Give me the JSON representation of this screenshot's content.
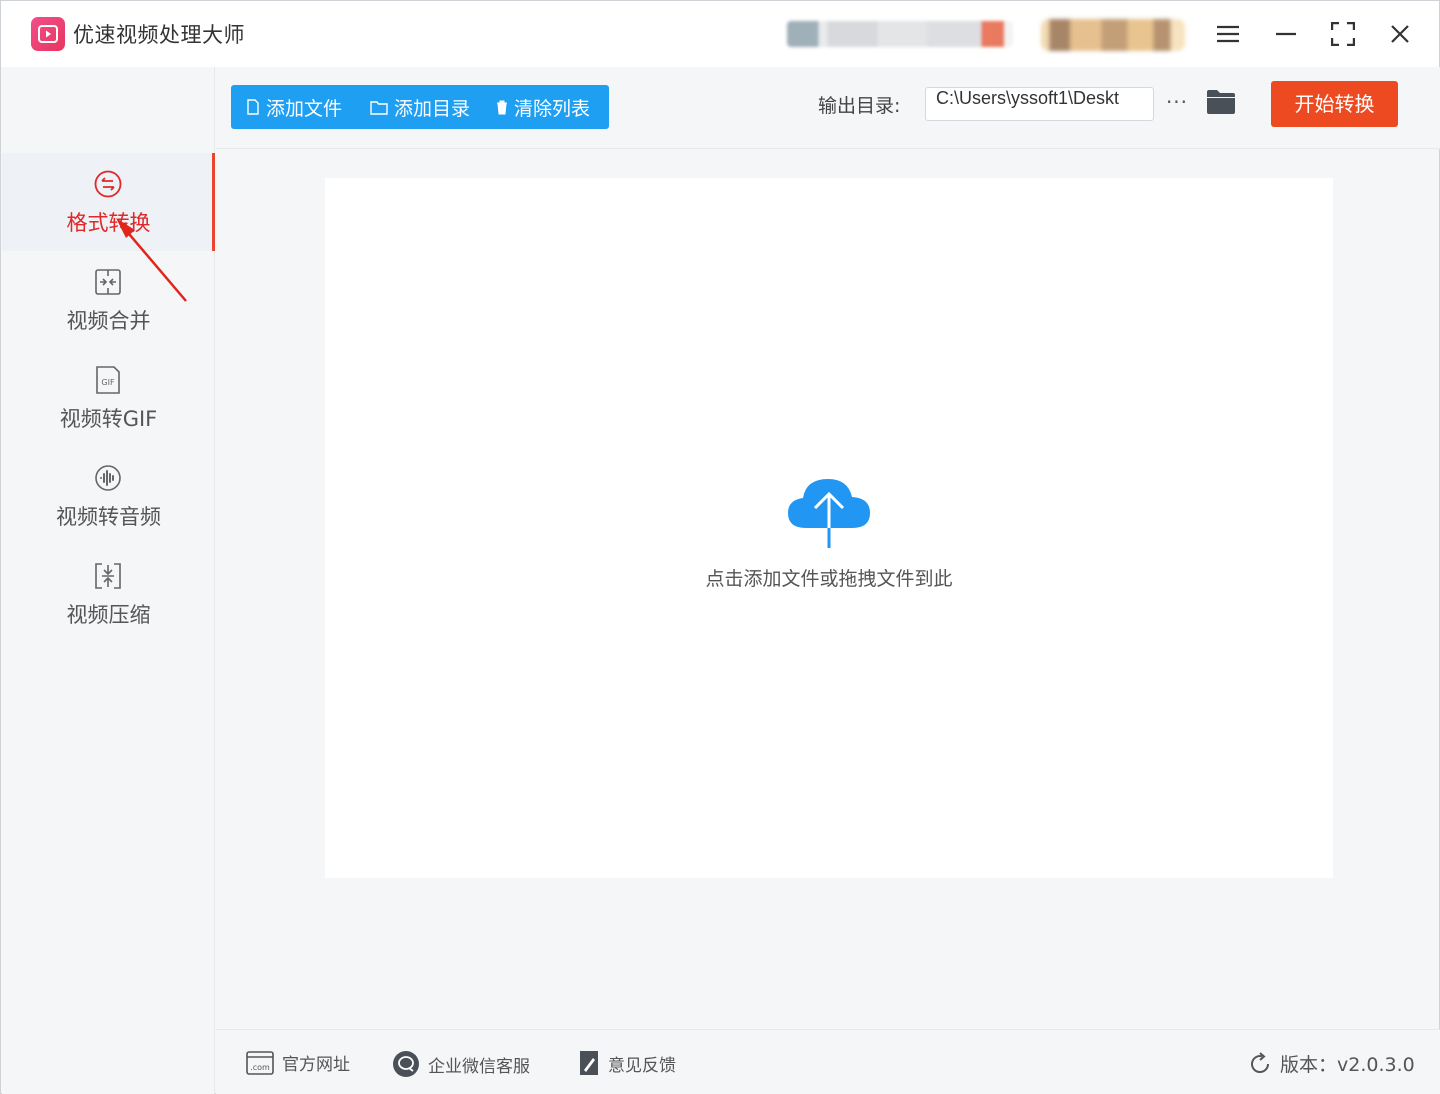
{
  "app": {
    "title": "优速视频处理大师",
    "logo_icon": "video-play-icon",
    "brand_color": "#e8355d"
  },
  "window_controls": [
    "menu-icon",
    "minimize-icon",
    "maximize-icon",
    "close-icon"
  ],
  "sidebar": {
    "items": [
      {
        "label": "格式转换",
        "icon": "convert-icon",
        "active": true
      },
      {
        "label": "视频合并",
        "icon": "merge-icon",
        "active": false
      },
      {
        "label": "视频转GIF",
        "icon": "gif-file-icon",
        "active": false
      },
      {
        "label": "视频转音频",
        "icon": "audio-icon",
        "active": false
      },
      {
        "label": "视频压缩",
        "icon": "compress-icon",
        "active": false
      }
    ],
    "active_color": "#e02828"
  },
  "toolbar": {
    "add_file": "添加文件",
    "add_dir": "添加目录",
    "clear_list": "清除列表",
    "output_label": "输出目录:",
    "output_path": "C:\\Users\\yssoft1\\Deskt",
    "more": "···",
    "start": "开始转换",
    "button_color": "#1e9ff2",
    "start_color": "#ed4a22"
  },
  "dropzone": {
    "hint": "点击添加文件或拖拽文件到此",
    "icon": "cloud-upload-icon"
  },
  "footer": {
    "website": "官方网址",
    "wechat": "企业微信客服",
    "feedback": "意见反馈",
    "version": "版本：v2.0.3.0"
  }
}
